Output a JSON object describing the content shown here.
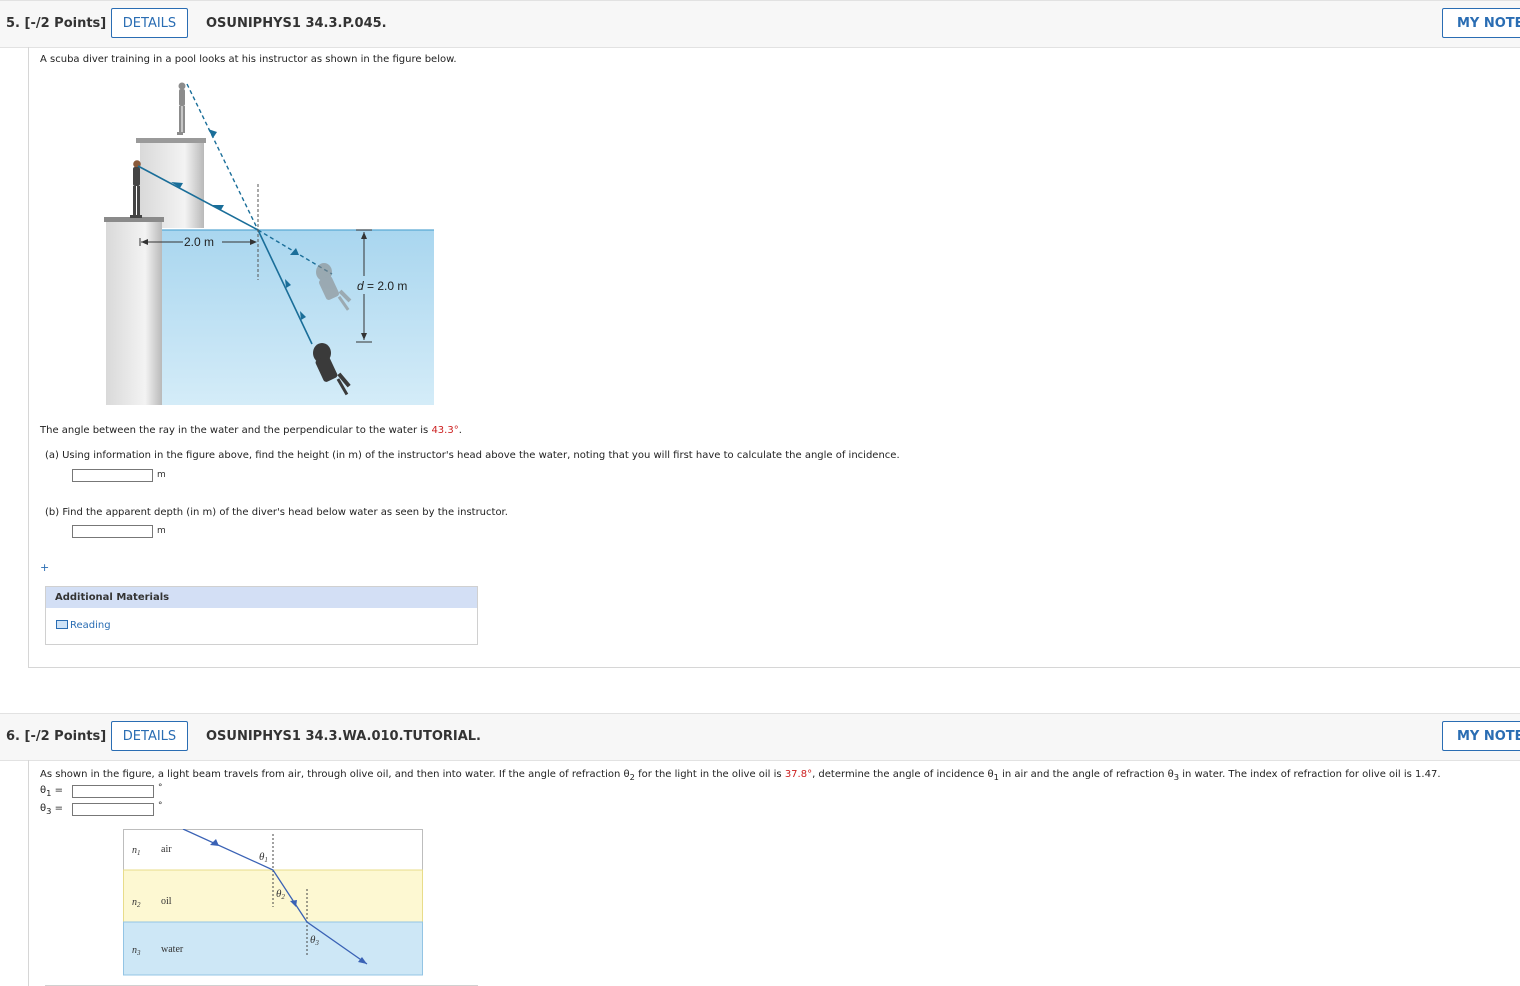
{
  "q5": {
    "number": "5. [-/2 Points]",
    "details_label": "DETAILS",
    "code": "OSUNIPHYS1 34.3.P.045.",
    "notes_label": "MY NOTES",
    "intro": "A scuba diver training in a pool looks at his instructor as shown in the figure below.",
    "figure": {
      "width_label": "2.0 m",
      "depth_var": "d",
      "depth_value": "= 2.0 m"
    },
    "angle_text_before": "The angle between the ray in the water and the perpendicular to the water is ",
    "angle_value": "43.3°",
    "angle_text_after": ".",
    "part_a": "(a)   Using information in the figure above, find the height (in m) of the instructor's head above the water, noting that you will first have to calculate the angle of incidence.",
    "part_a_unit": "m",
    "part_b": "(b)   Find the apparent depth (in m) of the diver's head below water as seen by the instructor.",
    "part_b_unit": "m",
    "plus": "+",
    "additional_materials": "Additional Materials",
    "reading_link": "Reading"
  },
  "q6": {
    "number": "6. [-/2 Points]",
    "details_label": "DETAILS",
    "code": "OSUNIPHYS1 34.3.WA.010.TUTORIAL.",
    "notes_label": "MY NOTES",
    "text_1": "As shown in the figure, a light beam travels from air, through olive oil, and then into water. If the angle of refraction θ",
    "sub_2": "2",
    "text_2": " for the light in the olive oil is ",
    "theta2_value": "37.8°",
    "text_3": ", determine the angle of incidence θ",
    "sub_1": "1",
    "text_4": " in air and the angle of refraction θ",
    "sub_3": "3",
    "text_5": " in water. The index of refraction for olive oil is 1.47.",
    "theta1_label": "θ",
    "theta1_sub": "1",
    "theta3_label": "θ",
    "theta3_sub": "3",
    "equals": "=",
    "degree": "°",
    "figure": {
      "n1": "n",
      "n1_sub": "1",
      "medium1": "air",
      "n2": "n",
      "n2_sub": "2",
      "medium2": "oil",
      "n3": "n",
      "n3_sub": "3",
      "medium3": "water",
      "t1": "θ",
      "t1_sub": "1",
      "t2": "θ",
      "t2_sub": "2",
      "t3": "θ",
      "t3_sub": "3"
    }
  }
}
